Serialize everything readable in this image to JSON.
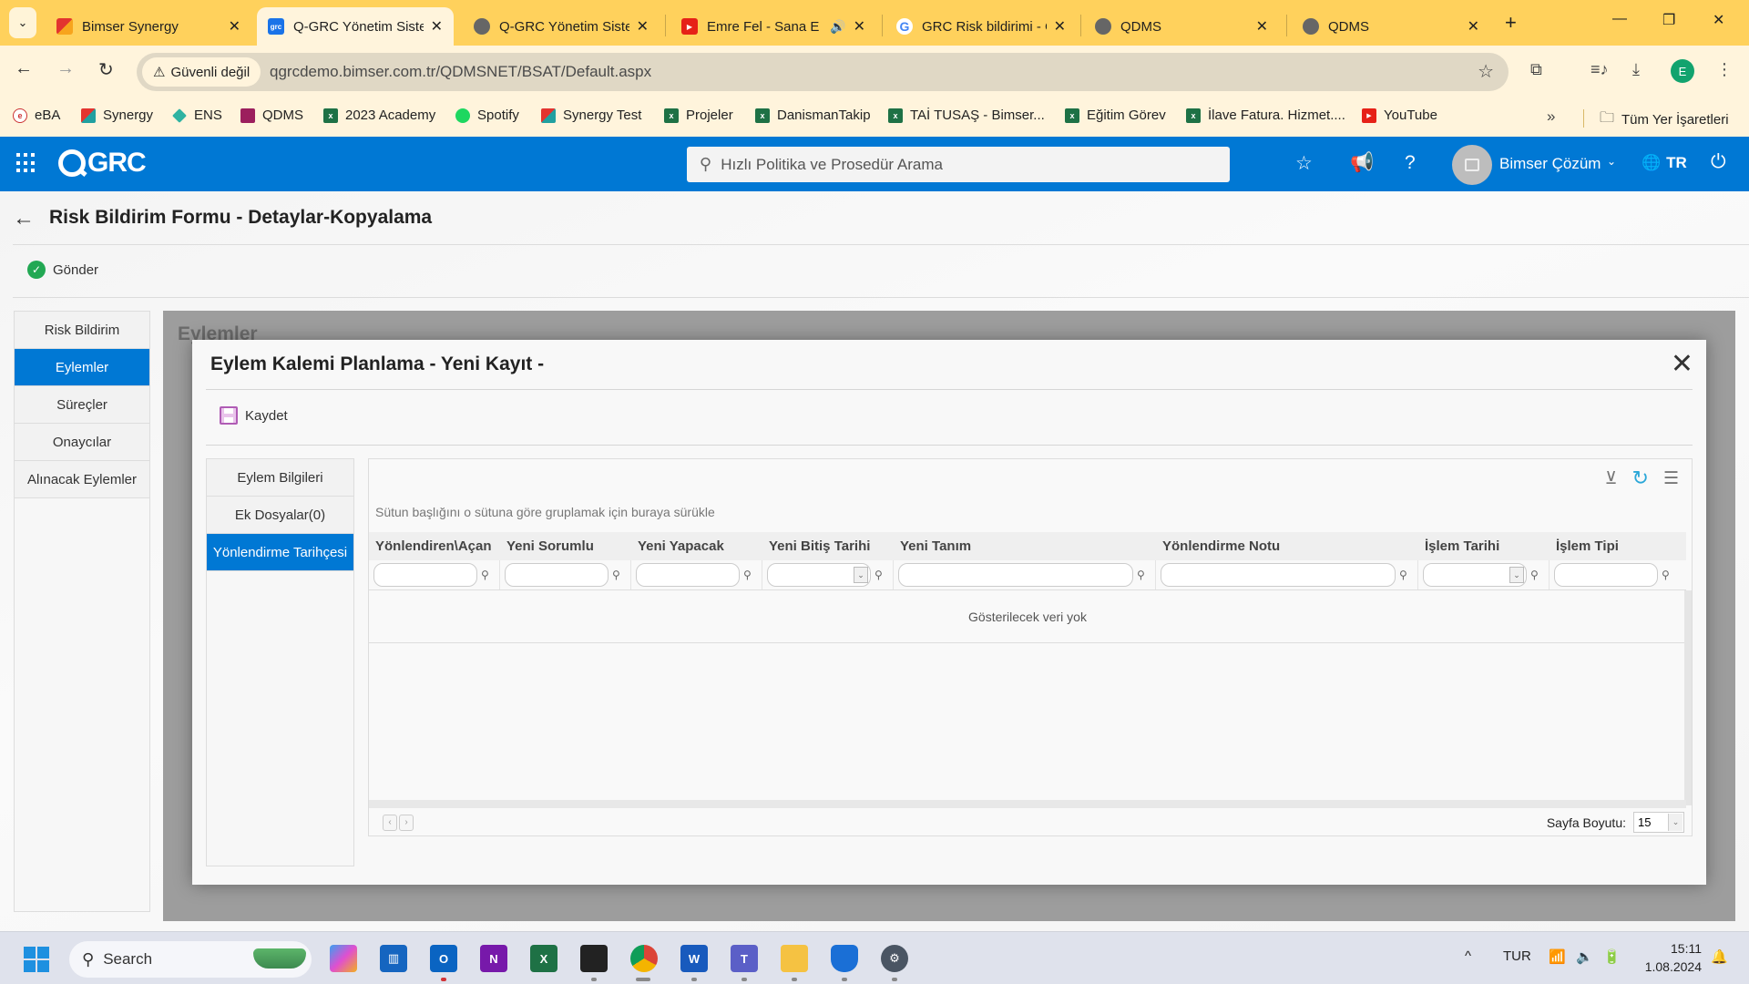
{
  "browser": {
    "tabs": [
      {
        "title": "Bimser Synergy",
        "favicon": "synergy-icon",
        "active": false
      },
      {
        "title": "Q-GRC Yönetim Siste",
        "favicon": "qgrc-icon",
        "active": true
      },
      {
        "title": "Q-GRC Yönetim Siste",
        "favicon": "globe-icon",
        "active": false
      },
      {
        "title": "Emre Fel - Sana E",
        "favicon": "youtube-icon",
        "active": false,
        "audio": true
      },
      {
        "title": "GRC Risk bildirimi - C",
        "favicon": "google-icon",
        "active": false
      },
      {
        "title": "QDMS",
        "favicon": "globe-icon",
        "active": false
      },
      {
        "title": "QDMS",
        "favicon": "globe-icon",
        "active": false
      }
    ],
    "security_label": "Güvenli değil",
    "url": "qgrcdemo.bimser.com.tr/QDMSNET/BSAT/Default.aspx",
    "profile_initial": "E",
    "bookmarks": [
      {
        "label": "eBA",
        "icon": "eba-icon"
      },
      {
        "label": "Synergy",
        "icon": "synergy-icon"
      },
      {
        "label": "ENS",
        "icon": "ens-icon"
      },
      {
        "label": "QDMS",
        "icon": "qdms-icon"
      },
      {
        "label": "2023 Academy",
        "icon": "excel-icon"
      },
      {
        "label": "Spotify",
        "icon": "spotify-icon"
      },
      {
        "label": "Synergy Test",
        "icon": "synergy-icon"
      },
      {
        "label": "Projeler",
        "icon": "excel-icon"
      },
      {
        "label": "DanismanTakip",
        "icon": "excel-icon"
      },
      {
        "label": "TAİ TUSAŞ - Bimser...",
        "icon": "excel-icon"
      },
      {
        "label": "Eğitim Görev",
        "icon": "excel-icon"
      },
      {
        "label": "İlave Fatura. Hizmet....",
        "icon": "excel-icon"
      },
      {
        "label": "YouTube",
        "icon": "youtube-icon"
      }
    ],
    "all_bookmarks_label": "Tüm Yer İşaretleri"
  },
  "app": {
    "logo_text": "GRC",
    "search_placeholder": "Hızlı Politika ve Prosedür Arama",
    "user_name": "Bimser Çözüm",
    "language": "TR"
  },
  "page": {
    "title": "Risk Bildirim Formu - Detaylar-Kopyalama",
    "send_label": "Gönder",
    "left_tabs": [
      {
        "label": "Risk Bildirim",
        "active": false
      },
      {
        "label": "Eylemler",
        "active": true
      },
      {
        "label": "Süreçler",
        "active": false
      },
      {
        "label": "Onaycılar",
        "active": false
      },
      {
        "label": "Alınacak Eylemler",
        "active": false
      }
    ],
    "background_section_title": "Eylemler"
  },
  "modal": {
    "title": "Eylem Kalemi Planlama - Yeni Kayıt -",
    "save_label": "Kaydet",
    "sub_tabs": [
      {
        "label": "Eylem Bilgileri",
        "active": false
      },
      {
        "label": "Ek Dosyalar(0)",
        "active": false
      },
      {
        "label": "Yönlendirme Tarihçesi",
        "active": true
      }
    ],
    "grid": {
      "group_panel_text": "Sütun başlığını o sütuna göre gruplamak için buraya sürükle",
      "columns": [
        {
          "label": "Yönlendiren\\Açan",
          "filter_type": "text"
        },
        {
          "label": "Yeni Sorumlu",
          "filter_type": "text"
        },
        {
          "label": "Yeni Yapacak",
          "filter_type": "text"
        },
        {
          "label": "Yeni Bitiş Tarihi",
          "filter_type": "date"
        },
        {
          "label": "Yeni Tanım",
          "filter_type": "text"
        },
        {
          "label": "Yönlendirme Notu",
          "filter_type": "text"
        },
        {
          "label": "İşlem Tarihi",
          "filter_type": "date"
        },
        {
          "label": "İşlem Tipi",
          "filter_type": "text"
        }
      ],
      "empty_text": "Gösterilecek veri yok",
      "page_size_label": "Sayfa Boyutu:",
      "page_size": "15"
    }
  },
  "taskbar": {
    "search_label": "Search",
    "language": "TUR",
    "time": "15:11",
    "date": "1.08.2024"
  }
}
